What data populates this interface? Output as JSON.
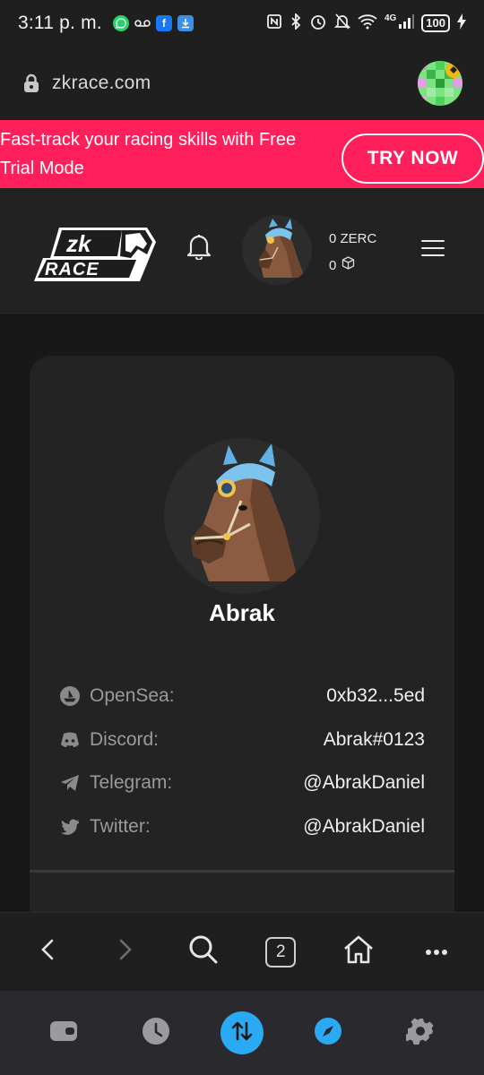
{
  "status_bar": {
    "time": "3:11 p. m.",
    "network": "4G",
    "battery": "100"
  },
  "browser": {
    "url": "zkrace.com",
    "tab_count": "2"
  },
  "promo": {
    "text": "Fast-track your racing skills with Free Trial Mode",
    "button_label": "TRY NOW"
  },
  "header": {
    "logo_text_top": "zk",
    "logo_text_bottom": "RACE",
    "zerc_balance": "0 ZERC",
    "cube_balance": "0"
  },
  "profile": {
    "name": "Abrak",
    "links": [
      {
        "icon": "opensea-icon",
        "label": "OpenSea:",
        "value": "0xb32...5ed"
      },
      {
        "icon": "discord-icon",
        "label": "Discord:",
        "value": "Abrak#0123"
      },
      {
        "icon": "telegram-icon",
        "label": "Telegram:",
        "value": "@AbrakDaniel"
      },
      {
        "icon": "twitter-icon",
        "label": "Twitter:",
        "value": "@AbrakDaniel"
      }
    ]
  },
  "colors": {
    "promo_bg": "#ff1f5a",
    "accent_blue": "#2aa9f5",
    "page_bg": "#1a1a1a",
    "card_bg": "#232323"
  }
}
